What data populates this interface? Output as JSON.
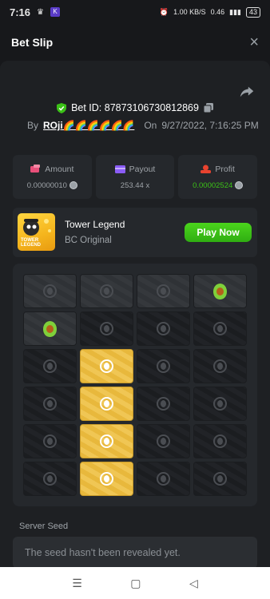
{
  "status_bar": {
    "time": "7:16",
    "net_speed": "1.00 KB/S",
    "signal_text": "0.46",
    "battery": "43"
  },
  "header": {
    "title": "Bet Slip",
    "close_symbol": "×"
  },
  "bet": {
    "id_label": "Bet ID: 87873106730812869",
    "by_label": "By",
    "user": "ROji🌈🌈🌈🌈🌈🌈",
    "on_label": "On",
    "datetime": "9/27/2022, 7:16:25 PM"
  },
  "stats": [
    {
      "label": "Amount",
      "value": "0.00000010",
      "icon": "wallet-icon",
      "color": "#e8507a"
    },
    {
      "label": "Payout",
      "value": "253.44 x",
      "icon": "card-icon",
      "color": "#8a5cf6"
    },
    {
      "label": "Profit",
      "value": "0.00002524",
      "icon": "coins-icon",
      "color": "#e8432f",
      "value_color": "#3bc117"
    }
  ],
  "game": {
    "title": "Tower Legend",
    "subtitle": "BC Original",
    "play_label": "Play Now",
    "thumb_text": "TOWER LEGEND"
  },
  "grid": {
    "columns": 4,
    "rows": [
      [
        "egg",
        "egg",
        "egg",
        "avocado"
      ],
      [
        "avocado",
        "egg",
        "egg",
        "egg"
      ],
      [
        "egg",
        "gold",
        "egg",
        "egg"
      ],
      [
        "egg",
        "gold",
        "egg",
        "egg"
      ],
      [
        "egg",
        "gold",
        "egg",
        "egg"
      ],
      [
        "egg",
        "gold",
        "egg",
        "egg"
      ]
    ],
    "active_rows": [
      0
    ]
  },
  "seed": {
    "label": "Server Seed",
    "value": "The seed hasn't been revealed yet."
  },
  "colors": {
    "accent_green": "#3bc117",
    "gold": "#f0c654",
    "panel": "#1e2023"
  }
}
